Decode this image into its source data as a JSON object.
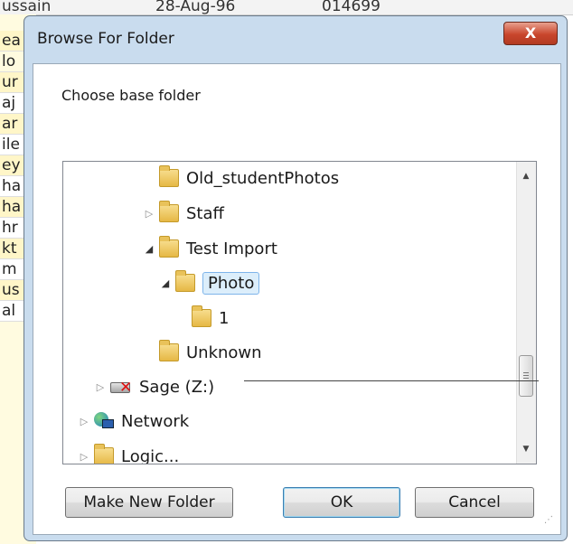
{
  "background": {
    "top_row": [
      "ussain",
      "28-Aug-96",
      "014699"
    ],
    "left_column": [
      "ea",
      "lo",
      "ur",
      "aj",
      "ar",
      "ile",
      "ey",
      "ha",
      "ha",
      "hr",
      "kt",
      "m",
      "us",
      "al"
    ]
  },
  "dialog": {
    "title": "Browse For Folder",
    "close_label": "X",
    "description": "Choose base folder",
    "tree": [
      {
        "label": "Old_studentPhotos",
        "icon": "folder-icon",
        "expander": "none"
      },
      {
        "label": "Staff",
        "icon": "folder-icon",
        "expander": "collapsed"
      },
      {
        "label": "Test Import",
        "icon": "folder-icon",
        "expander": "expanded"
      },
      {
        "label": "Photo",
        "icon": "folder-icon",
        "expander": "expanded",
        "selected": true
      },
      {
        "label": "1",
        "icon": "folder-icon",
        "expander": "none"
      },
      {
        "label": "Unknown",
        "icon": "folder-icon",
        "expander": "none"
      },
      {
        "label": "Sage (Z:)",
        "icon": "disconnected-drive-icon",
        "expander": "collapsed"
      },
      {
        "label": "Network",
        "icon": "network-icon",
        "expander": "collapsed"
      },
      {
        "label": "Logic...",
        "icon": "folder-icon",
        "expander": "collapsed"
      }
    ],
    "buttons": {
      "make_new_folder": "Make New Folder",
      "ok": "OK",
      "cancel": "Cancel"
    }
  },
  "colors": {
    "selection_bg": "#dceefb",
    "selection_border": "#7eb4ea",
    "close_button": "#c9462c",
    "frame": "#c9dcee"
  }
}
